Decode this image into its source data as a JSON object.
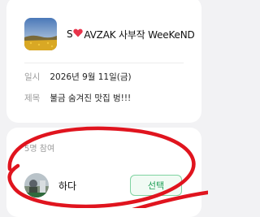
{
  "event": {
    "title_prefix": "S",
    "title_heart": "♥",
    "title_suffix": "AVZAK 사부작 WeeKeND",
    "thumbnail_icon": "sunset-field-photo",
    "date_label": "일시",
    "date_value": "2026년 9월 11일(금)",
    "subject_label": "제목",
    "subject_value": "불금 숨겨진 맛집 벙!!!"
  },
  "participants": {
    "count_label": "5명 참여",
    "items": [
      {
        "name": "하다",
        "avatar_icon": "profile-photo",
        "select_label": "선택"
      }
    ]
  },
  "colors": {
    "heart": "#e8334a",
    "accent_green": "#1e9e56",
    "annotation_red": "#e0141e"
  }
}
